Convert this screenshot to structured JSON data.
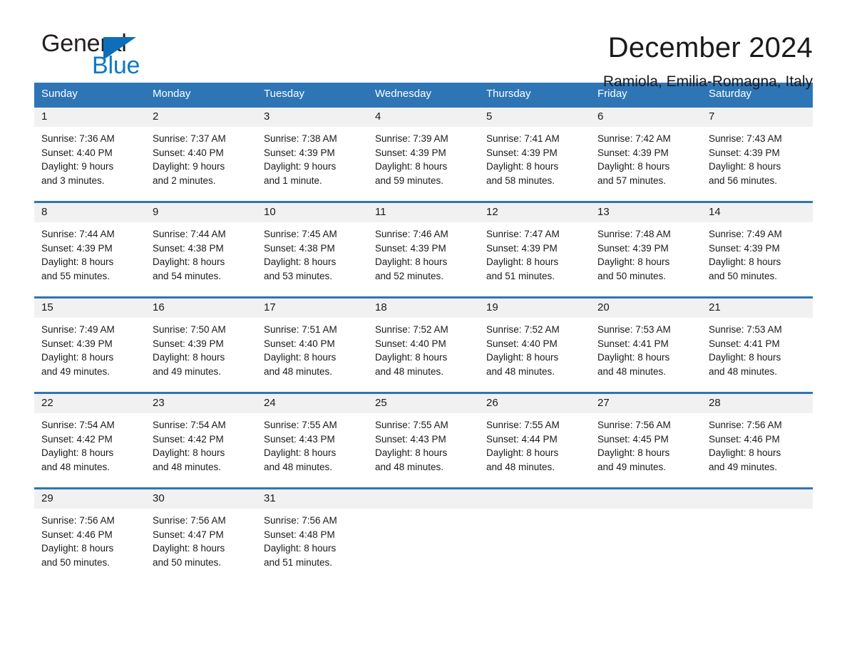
{
  "brand": {
    "name_part1": "General",
    "name_part2": "Blue",
    "triangle_color": "#0d6fb8",
    "blue_color": "#0d7ac4"
  },
  "header": {
    "title": "December 2024",
    "subtitle": "Ramiola, Emilia-Romagna, Italy"
  },
  "theme": {
    "accent": "#2e75b6",
    "daynum_band": "#f1f1f1",
    "text": "#1a1a1a"
  },
  "calendar": {
    "weekday_headers": [
      "Sunday",
      "Monday",
      "Tuesday",
      "Wednesday",
      "Thursday",
      "Friday",
      "Saturday"
    ],
    "weeks": [
      [
        {
          "day": "1",
          "info": "Sunrise: 7:36 AM\nSunset: 4:40 PM\nDaylight: 9 hours\nand 3 minutes."
        },
        {
          "day": "2",
          "info": "Sunrise: 7:37 AM\nSunset: 4:40 PM\nDaylight: 9 hours\nand 2 minutes."
        },
        {
          "day": "3",
          "info": "Sunrise: 7:38 AM\nSunset: 4:39 PM\nDaylight: 9 hours\nand 1 minute."
        },
        {
          "day": "4",
          "info": "Sunrise: 7:39 AM\nSunset: 4:39 PM\nDaylight: 8 hours\nand 59 minutes."
        },
        {
          "day": "5",
          "info": "Sunrise: 7:41 AM\nSunset: 4:39 PM\nDaylight: 8 hours\nand 58 minutes."
        },
        {
          "day": "6",
          "info": "Sunrise: 7:42 AM\nSunset: 4:39 PM\nDaylight: 8 hours\nand 57 minutes."
        },
        {
          "day": "7",
          "info": "Sunrise: 7:43 AM\nSunset: 4:39 PM\nDaylight: 8 hours\nand 56 minutes."
        }
      ],
      [
        {
          "day": "8",
          "info": "Sunrise: 7:44 AM\nSunset: 4:39 PM\nDaylight: 8 hours\nand 55 minutes."
        },
        {
          "day": "9",
          "info": "Sunrise: 7:44 AM\nSunset: 4:38 PM\nDaylight: 8 hours\nand 54 minutes."
        },
        {
          "day": "10",
          "info": "Sunrise: 7:45 AM\nSunset: 4:38 PM\nDaylight: 8 hours\nand 53 minutes."
        },
        {
          "day": "11",
          "info": "Sunrise: 7:46 AM\nSunset: 4:39 PM\nDaylight: 8 hours\nand 52 minutes."
        },
        {
          "day": "12",
          "info": "Sunrise: 7:47 AM\nSunset: 4:39 PM\nDaylight: 8 hours\nand 51 minutes."
        },
        {
          "day": "13",
          "info": "Sunrise: 7:48 AM\nSunset: 4:39 PM\nDaylight: 8 hours\nand 50 minutes."
        },
        {
          "day": "14",
          "info": "Sunrise: 7:49 AM\nSunset: 4:39 PM\nDaylight: 8 hours\nand 50 minutes."
        }
      ],
      [
        {
          "day": "15",
          "info": "Sunrise: 7:49 AM\nSunset: 4:39 PM\nDaylight: 8 hours\nand 49 minutes."
        },
        {
          "day": "16",
          "info": "Sunrise: 7:50 AM\nSunset: 4:39 PM\nDaylight: 8 hours\nand 49 minutes."
        },
        {
          "day": "17",
          "info": "Sunrise: 7:51 AM\nSunset: 4:40 PM\nDaylight: 8 hours\nand 48 minutes."
        },
        {
          "day": "18",
          "info": "Sunrise: 7:52 AM\nSunset: 4:40 PM\nDaylight: 8 hours\nand 48 minutes."
        },
        {
          "day": "19",
          "info": "Sunrise: 7:52 AM\nSunset: 4:40 PM\nDaylight: 8 hours\nand 48 minutes."
        },
        {
          "day": "20",
          "info": "Sunrise: 7:53 AM\nSunset: 4:41 PM\nDaylight: 8 hours\nand 48 minutes."
        },
        {
          "day": "21",
          "info": "Sunrise: 7:53 AM\nSunset: 4:41 PM\nDaylight: 8 hours\nand 48 minutes."
        }
      ],
      [
        {
          "day": "22",
          "info": "Sunrise: 7:54 AM\nSunset: 4:42 PM\nDaylight: 8 hours\nand 48 minutes."
        },
        {
          "day": "23",
          "info": "Sunrise: 7:54 AM\nSunset: 4:42 PM\nDaylight: 8 hours\nand 48 minutes."
        },
        {
          "day": "24",
          "info": "Sunrise: 7:55 AM\nSunset: 4:43 PM\nDaylight: 8 hours\nand 48 minutes."
        },
        {
          "day": "25",
          "info": "Sunrise: 7:55 AM\nSunset: 4:43 PM\nDaylight: 8 hours\nand 48 minutes."
        },
        {
          "day": "26",
          "info": "Sunrise: 7:55 AM\nSunset: 4:44 PM\nDaylight: 8 hours\nand 48 minutes."
        },
        {
          "day": "27",
          "info": "Sunrise: 7:56 AM\nSunset: 4:45 PM\nDaylight: 8 hours\nand 49 minutes."
        },
        {
          "day": "28",
          "info": "Sunrise: 7:56 AM\nSunset: 4:46 PM\nDaylight: 8 hours\nand 49 minutes."
        }
      ],
      [
        {
          "day": "29",
          "info": "Sunrise: 7:56 AM\nSunset: 4:46 PM\nDaylight: 8 hours\nand 50 minutes."
        },
        {
          "day": "30",
          "info": "Sunrise: 7:56 AM\nSunset: 4:47 PM\nDaylight: 8 hours\nand 50 minutes."
        },
        {
          "day": "31",
          "info": "Sunrise: 7:56 AM\nSunset: 4:48 PM\nDaylight: 8 hours\nand 51 minutes."
        },
        {
          "day": "",
          "info": ""
        },
        {
          "day": "",
          "info": ""
        },
        {
          "day": "",
          "info": ""
        },
        {
          "day": "",
          "info": ""
        }
      ]
    ]
  }
}
